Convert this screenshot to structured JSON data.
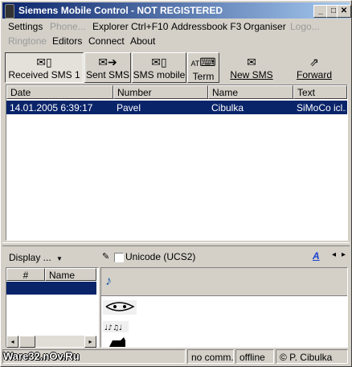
{
  "window": {
    "title": "Siemens Mobile Control - NOT REGISTERED",
    "min_label": "_",
    "max_label": "□",
    "close_label": "✕"
  },
  "menu": {
    "row1": [
      {
        "label": "Settings",
        "enabled": true
      },
      {
        "label": "Phone...",
        "enabled": false
      },
      {
        "label": "Explorer Ctrl+F10",
        "enabled": true
      },
      {
        "label": "Addressbook F3",
        "enabled": true
      },
      {
        "label": "Organiser",
        "enabled": true
      },
      {
        "label": "Logo...",
        "enabled": false
      }
    ],
    "row2": [
      {
        "label": "Ringtone",
        "enabled": false
      },
      {
        "label": "Editors",
        "enabled": true
      },
      {
        "label": "Connect",
        "enabled": true
      },
      {
        "label": "About",
        "enabled": true
      }
    ]
  },
  "toolbar": {
    "tabs": [
      {
        "label": "Received SMS  1",
        "icon": "inbox-icon"
      },
      {
        "label": "Sent SMS",
        "icon": "outbox-icon"
      },
      {
        "label": "SMS mobile",
        "icon": "phone-sms-icon"
      },
      {
        "label": "Term",
        "icon": "at-terminal-icon",
        "icon_text": "AT"
      }
    ],
    "buttons": [
      {
        "label": "New SMS",
        "icon": "new-sms-icon"
      },
      {
        "label": "Forward",
        "icon": "forward-icon"
      }
    ]
  },
  "sms_list": {
    "columns": [
      "Date",
      "Number",
      "Name",
      "Text"
    ],
    "rows": [
      {
        "date": "14.01.2005 6:39:17",
        "number": "Pavel",
        "name": "Cibulka",
        "text": "SiMoCo icl..."
      }
    ]
  },
  "bottom": {
    "display_label": "Display ...",
    "unicode_label": "Unicode (UCS2)",
    "unicode_checked": false,
    "font_icon_text": "A",
    "left_columns": [
      "#",
      "Name"
    ]
  },
  "status": {
    "watermark": "Ware32.nOv.Ru",
    "connection": "no comm.",
    "mode": "offline",
    "copyright": "© P. Cibulka"
  }
}
